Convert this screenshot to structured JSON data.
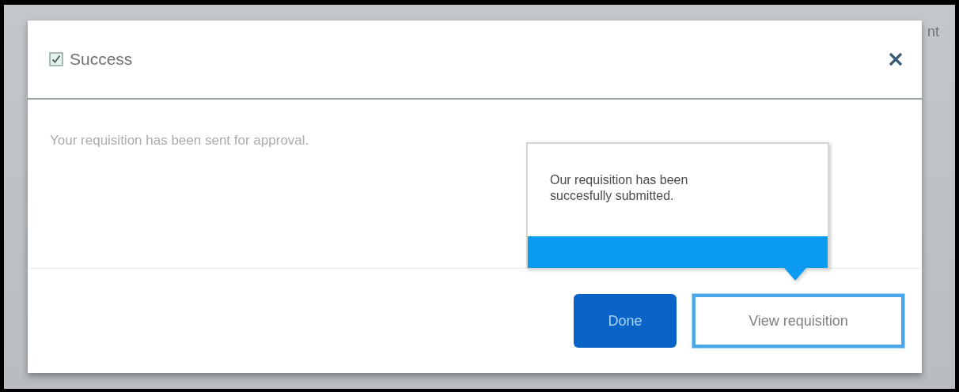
{
  "background": {
    "text_fragment": "nt"
  },
  "dialog": {
    "title": "Success",
    "message": "Your requisition has been sent for approval.",
    "buttons": [
      {
        "label": "Done",
        "kind": "primary"
      },
      {
        "label": "View requisition",
        "kind": "secondary"
      }
    ]
  },
  "tooltip": {
    "text": "Our requisition has been succesfully submitted."
  }
}
